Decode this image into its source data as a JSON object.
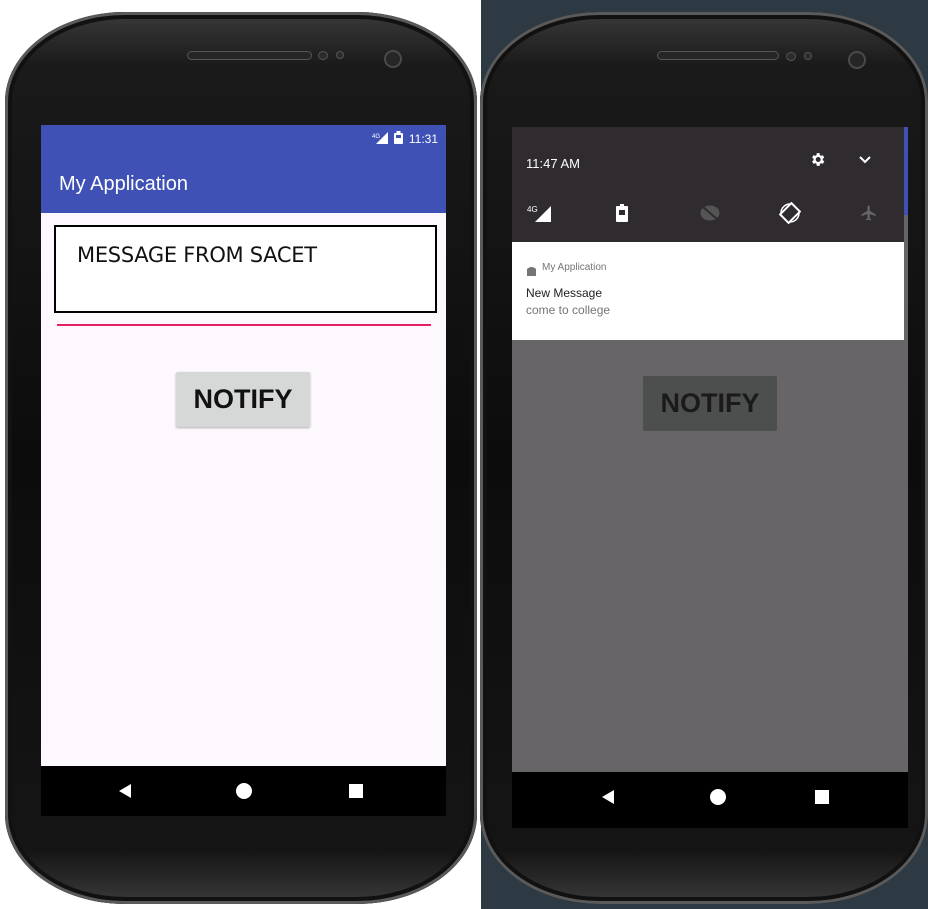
{
  "left_phone": {
    "status_bar": {
      "network": "4G",
      "time": "11:31"
    },
    "app_bar": {
      "title": "My Application"
    },
    "message_field": {
      "value": "MESSAGE FROM SACET"
    },
    "notify_button": {
      "label": "NOTIFY"
    },
    "nav": {
      "back": "back-icon",
      "home": "home-icon",
      "recents": "recents-icon"
    }
  },
  "right_phone": {
    "shade": {
      "time": "11:47 AM",
      "quick_settings": [
        "network-4g-icon",
        "battery-saver-icon",
        "do-not-disturb-icon",
        "auto-rotate-icon",
        "airplane-mode-icon"
      ]
    },
    "notification": {
      "app_name": "My Application",
      "title": "New Message",
      "text": "come to college"
    },
    "notify_button": {
      "label": "NOTIFY"
    },
    "nav": {
      "back": "back-icon",
      "home": "home-icon",
      "recents": "recents-icon"
    }
  },
  "colors": {
    "primary": "#3f51b5",
    "accent_underline": "#e91e63",
    "shade_bg": "#2f2b2f",
    "dimmed_bg": "#676568"
  }
}
